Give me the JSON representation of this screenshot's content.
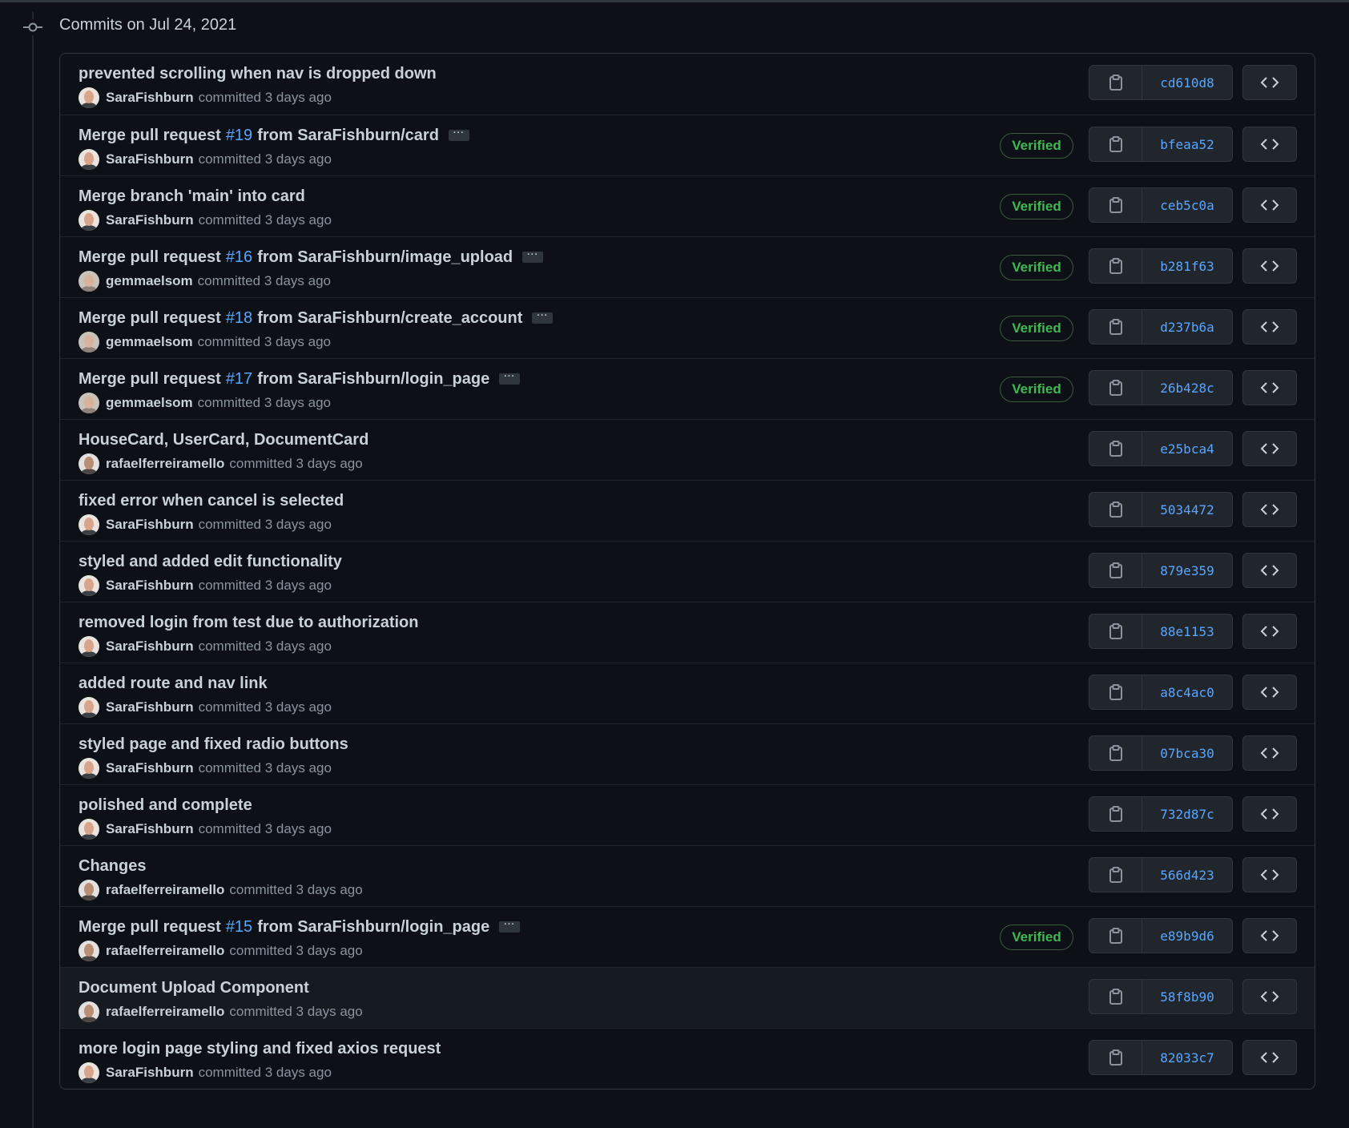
{
  "group": {
    "heading": "Commits on Jul 24, 2021"
  },
  "badges": {
    "verified_label": "Verified"
  },
  "icons": {
    "timeline": "git-commit-icon",
    "copy": "clipboard-icon",
    "browse": "code-brackets-icon",
    "expand": "ellipsis-icon"
  },
  "colors": {
    "background": "#0d1117",
    "link": "#58a6ff",
    "verified": "#3fb950",
    "text": "#c9d1d9",
    "muted": "#8b949e"
  },
  "commits": [
    {
      "title_before": "prevented scrolling when nav is dropped down",
      "pr": "",
      "title_after": "",
      "expandable": false,
      "author": "SaraFishburn",
      "action": "committed",
      "time": "3 days ago",
      "verified": false,
      "sha": "cd610d8",
      "avatar": "sara"
    },
    {
      "title_before": "Merge pull request",
      "pr": "#19",
      "title_after": "from SaraFishburn/card",
      "expandable": true,
      "author": "SaraFishburn",
      "action": "committed",
      "time": "3 days ago",
      "verified": true,
      "sha": "bfeaa52",
      "avatar": "sara"
    },
    {
      "title_before": "Merge branch 'main' into card",
      "pr": "",
      "title_after": "",
      "expandable": false,
      "author": "SaraFishburn",
      "action": "committed",
      "time": "3 days ago",
      "verified": true,
      "sha": "ceb5c0a",
      "avatar": "sara"
    },
    {
      "title_before": "Merge pull request",
      "pr": "#16",
      "title_after": "from SaraFishburn/image_upload",
      "expandable": true,
      "author": "gemmaelsom",
      "action": "committed",
      "time": "3 days ago",
      "verified": true,
      "sha": "b281f63",
      "avatar": "gemma"
    },
    {
      "title_before": "Merge pull request",
      "pr": "#18",
      "title_after": "from SaraFishburn/create_account",
      "expandable": true,
      "author": "gemmaelsom",
      "action": "committed",
      "time": "3 days ago",
      "verified": true,
      "sha": "d237b6a",
      "avatar": "gemma"
    },
    {
      "title_before": "Merge pull request",
      "pr": "#17",
      "title_after": "from SaraFishburn/login_page",
      "expandable": true,
      "author": "gemmaelsom",
      "action": "committed",
      "time": "3 days ago",
      "verified": true,
      "sha": "26b428c",
      "avatar": "gemma"
    },
    {
      "title_before": "HouseCard, UserCard, DocumentCard",
      "pr": "",
      "title_after": "",
      "expandable": false,
      "author": "rafaelferreiramello",
      "action": "committed",
      "time": "3 days ago",
      "verified": false,
      "sha": "e25bca4",
      "avatar": "rafael"
    },
    {
      "title_before": "fixed error when cancel is selected",
      "pr": "",
      "title_after": "",
      "expandable": false,
      "author": "SaraFishburn",
      "action": "committed",
      "time": "3 days ago",
      "verified": false,
      "sha": "5034472",
      "avatar": "sara"
    },
    {
      "title_before": "styled and added edit functionality",
      "pr": "",
      "title_after": "",
      "expandable": false,
      "author": "SaraFishburn",
      "action": "committed",
      "time": "3 days ago",
      "verified": false,
      "sha": "879e359",
      "avatar": "sara"
    },
    {
      "title_before": "removed login from test due to authorization",
      "pr": "",
      "title_after": "",
      "expandable": false,
      "author": "SaraFishburn",
      "action": "committed",
      "time": "3 days ago",
      "verified": false,
      "sha": "88e1153",
      "avatar": "sara"
    },
    {
      "title_before": "added route and nav link",
      "pr": "",
      "title_after": "",
      "expandable": false,
      "author": "SaraFishburn",
      "action": "committed",
      "time": "3 days ago",
      "verified": false,
      "sha": "a8c4ac0",
      "avatar": "sara"
    },
    {
      "title_before": "styled page and fixed radio buttons",
      "pr": "",
      "title_after": "",
      "expandable": false,
      "author": "SaraFishburn",
      "action": "committed",
      "time": "3 days ago",
      "verified": false,
      "sha": "07bca30",
      "avatar": "sara"
    },
    {
      "title_before": "polished and complete",
      "pr": "",
      "title_after": "",
      "expandable": false,
      "author": "SaraFishburn",
      "action": "committed",
      "time": "3 days ago",
      "verified": false,
      "sha": "732d87c",
      "avatar": "sara"
    },
    {
      "title_before": "Changes",
      "pr": "",
      "title_after": "",
      "expandable": false,
      "author": "rafaelferreiramello",
      "action": "committed",
      "time": "3 days ago",
      "verified": false,
      "sha": "566d423",
      "avatar": "rafael"
    },
    {
      "title_before": "Merge pull request",
      "pr": "#15",
      "title_after": "from SaraFishburn/login_page",
      "expandable": true,
      "author": "rafaelferreiramello",
      "action": "committed",
      "time": "3 days ago",
      "verified": true,
      "sha": "e89b9d6",
      "avatar": "rafael"
    },
    {
      "title_before": "Document Upload Component",
      "pr": "",
      "title_after": "",
      "expandable": false,
      "author": "rafaelferreiramello",
      "action": "committed",
      "time": "3 days ago",
      "verified": false,
      "sha": "58f8b90",
      "avatar": "rafael",
      "highlighted": true
    },
    {
      "title_before": "more login page styling and fixed axios request",
      "pr": "",
      "title_after": "",
      "expandable": false,
      "author": "SaraFishburn",
      "action": "committed",
      "time": "3 days ago",
      "verified": false,
      "sha": "82033c7",
      "avatar": "sara"
    }
  ]
}
